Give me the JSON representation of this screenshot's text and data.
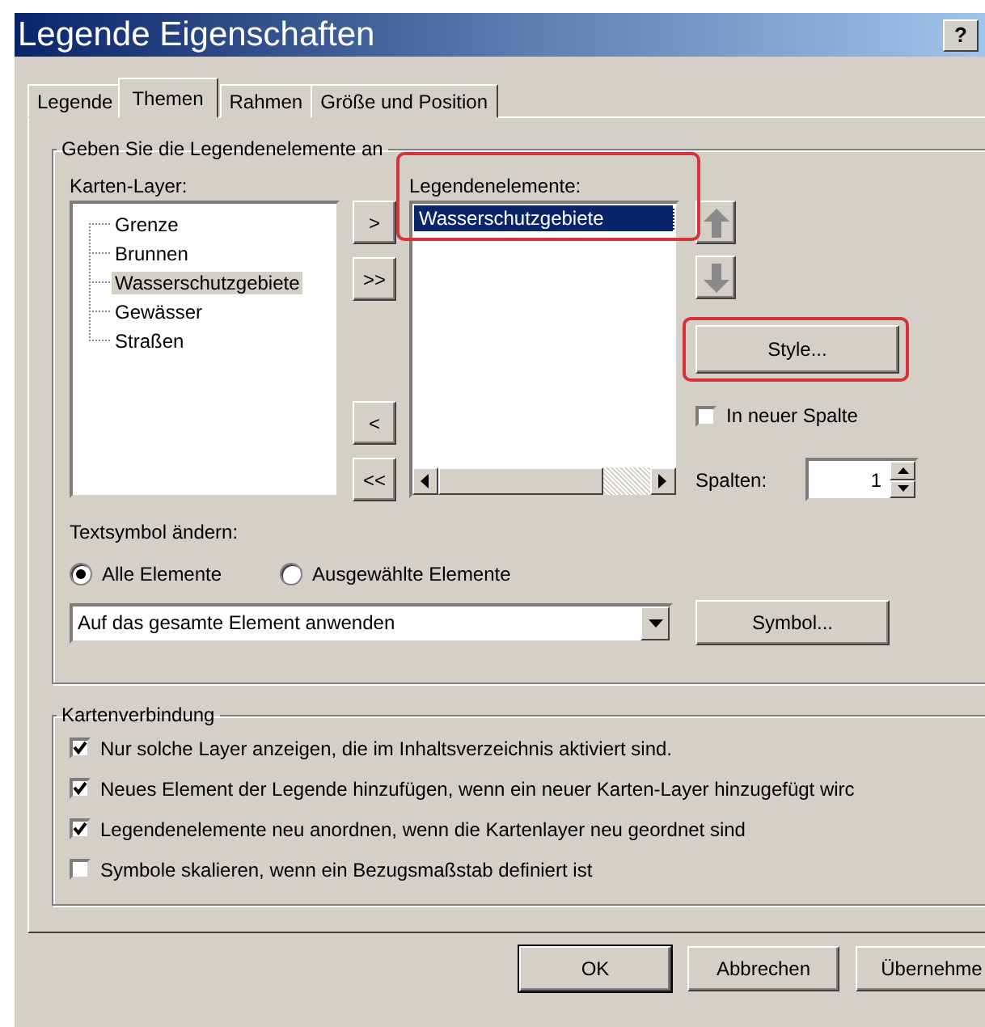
{
  "window": {
    "title": "Legende Eigenschaften",
    "help_button": "?"
  },
  "tabs": [
    {
      "label": "Legende",
      "selected": false
    },
    {
      "label": "Themen",
      "selected": true
    },
    {
      "label": "Rahmen",
      "selected": false
    },
    {
      "label": "Größe und Position",
      "selected": false
    }
  ],
  "items_group": {
    "title": "Geben Sie die Legendenelemente an",
    "layers_label": "Karten-Layer:",
    "layers": [
      {
        "label": "Grenze",
        "selected": false
      },
      {
        "label": "Brunnen",
        "selected": false
      },
      {
        "label": "Wasserschutzgebiete",
        "selected": true
      },
      {
        "label": "Gewässer",
        "selected": false
      },
      {
        "label": "Straßen",
        "selected": false
      }
    ],
    "add_buttons": [
      ">",
      ">>"
    ],
    "remove_buttons": [
      "<",
      "<<"
    ],
    "legend_label": "Legendenelemente:",
    "legend_items": [
      {
        "label": "Wasserschutzgebiete",
        "selected": true
      }
    ],
    "style_button": "Style...",
    "new_column": {
      "label": "In neuer Spalte",
      "checked": false
    },
    "columns_label": "Spalten:",
    "columns_value": "1",
    "text_symbol_label": "Textsymbol ändern:",
    "text_symbol_options": [
      {
        "label": "Alle Elemente",
        "selected": true
      },
      {
        "label": "Ausgewählte Elemente",
        "selected": false
      }
    ],
    "apply_select": "Auf das gesamte Element anwenden",
    "symbol_button": "Symbol..."
  },
  "map_connection": {
    "title": "Kartenverbindung",
    "options": [
      {
        "label": "Nur solche Layer anzeigen, die im Inhaltsverzeichnis aktiviert sind.",
        "checked": true
      },
      {
        "label": "Neues Element der Legende hinzufügen, wenn ein neuer Karten-Layer hinzugefügt wirc",
        "checked": true
      },
      {
        "label": "Legendenelemente neu anordnen, wenn die Kartenlayer neu geordnet sind",
        "checked": true
      },
      {
        "label": "Symbole skalieren, wenn ein Bezugsmaßstab definiert ist",
        "checked": false
      }
    ]
  },
  "buttons": [
    "OK",
    "Abbrechen",
    "Übernehme"
  ]
}
